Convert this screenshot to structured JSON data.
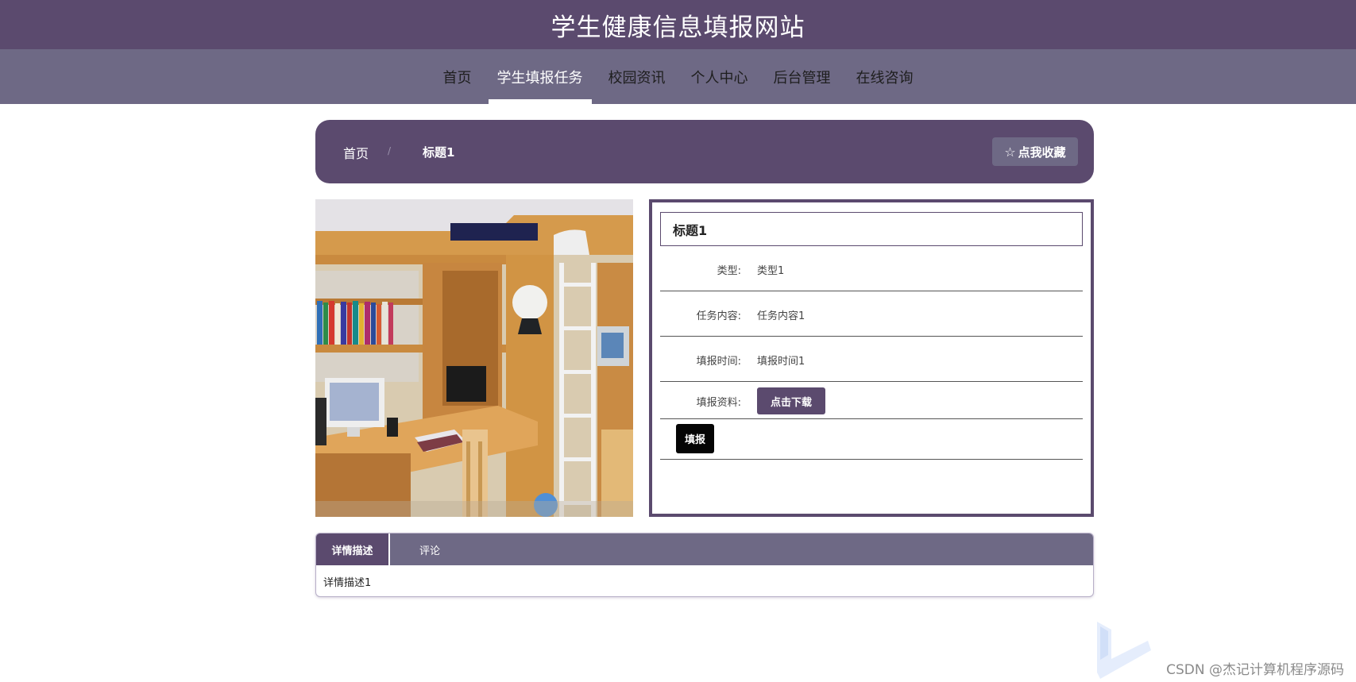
{
  "header": {
    "title": "学生健康信息填报网站"
  },
  "nav": {
    "items": [
      {
        "label": "首页"
      },
      {
        "label": "学生填报任务"
      },
      {
        "label": "校园资讯"
      },
      {
        "label": "个人中心"
      },
      {
        "label": "后台管理"
      },
      {
        "label": "在线咨询"
      }
    ],
    "active_index": 1
  },
  "breadcrumb": {
    "home": "首页",
    "separator": "/",
    "current": "标题1"
  },
  "favorite_button": {
    "icon": "star-outline-icon",
    "label": "点我收藏"
  },
  "detail": {
    "title": "标题1",
    "rows": [
      {
        "label": "类型:",
        "value": "类型1"
      },
      {
        "label": "任务内容:",
        "value": "任务内容1"
      },
      {
        "label": "填报时间:",
        "value": "填报时间1"
      }
    ],
    "attachment_label": "填报资料:",
    "download_label": "点击下载",
    "submit_label": "填报"
  },
  "tabs": {
    "items": [
      {
        "label": "详情描述"
      },
      {
        "label": "评论"
      }
    ],
    "active_index": 0,
    "content": "详情描述1"
  },
  "watermark": {
    "text": "CSDN @杰记计算机程序源码"
  },
  "colors": {
    "primary": "#5b4a6e",
    "nav": "#6e6985",
    "submit": "#050505",
    "white": "#ffffff"
  }
}
